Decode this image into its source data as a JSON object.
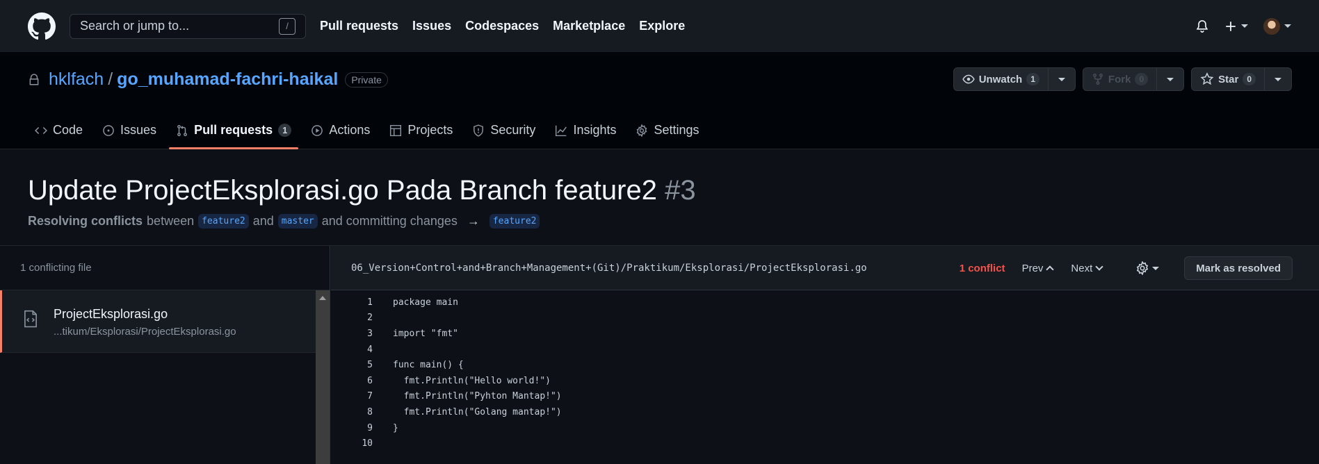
{
  "header": {
    "search_placeholder": "Search or jump to...",
    "search_shortcut": "/",
    "nav": [
      "Pull requests",
      "Issues",
      "Codespaces",
      "Marketplace",
      "Explore"
    ]
  },
  "repo": {
    "owner": "hklfach",
    "separator": "/",
    "name": "go_muhamad-fachri-haikal",
    "visibility": "Private",
    "unwatch_label": "Unwatch",
    "unwatch_count": "1",
    "fork_label": "Fork",
    "fork_count": "0",
    "star_label": "Star",
    "star_count": "0"
  },
  "tabs": {
    "code": "Code",
    "issues": "Issues",
    "pull_requests": "Pull requests",
    "pull_requests_count": "1",
    "actions": "Actions",
    "projects": "Projects",
    "security": "Security",
    "insights": "Insights",
    "settings": "Settings"
  },
  "pr": {
    "title": "Update ProjectEksplorasi.go Pada Branch feature2",
    "number": "#3",
    "sub_bold": "Resolving conflicts",
    "sub_between": "between",
    "head_branch": "feature2",
    "sub_and": "and",
    "base_branch": "master",
    "sub_committing": "and committing changes",
    "arrow": "→",
    "target_branch": "feature2"
  },
  "sidebar": {
    "heading": "1 conflicting file",
    "file_name": "ProjectEksplorasi.go",
    "file_path": "...tikum/Eksplorasi/ProjectEksplorasi.go"
  },
  "editor": {
    "path": "06_Version+Control+and+Branch+Management+(Git)/Praktikum/Eksplorasi/ProjectEksplorasi.go",
    "conflict_count": "1 conflict",
    "prev_label": "Prev",
    "next_label": "Next",
    "resolve_label": "Mark as resolved",
    "lines": [
      {
        "n": "1",
        "t": "package main"
      },
      {
        "n": "2",
        "t": ""
      },
      {
        "n": "3",
        "t": "import \"fmt\""
      },
      {
        "n": "4",
        "t": ""
      },
      {
        "n": "5",
        "t": "func main() {"
      },
      {
        "n": "6",
        "t": "  fmt.Println(\"Hello world!\")"
      },
      {
        "n": "7",
        "t": "  fmt.Println(\"Pyhton Mantap!\")"
      },
      {
        "n": "8",
        "t": "  fmt.Println(\"Golang mantap!\")"
      },
      {
        "n": "9",
        "t": "}"
      },
      {
        "n": "10",
        "t": ""
      }
    ]
  },
  "colors": {
    "accent_link": "#58a6ff",
    "active_tab_underline": "#f78166",
    "conflict_red": "#f85149",
    "background": "#0d1117"
  }
}
